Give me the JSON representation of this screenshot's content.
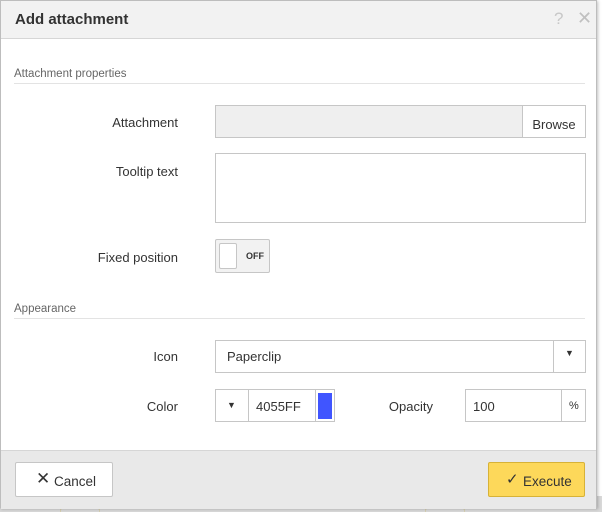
{
  "dialog": {
    "title": "Add attachment",
    "help_icon": "question-mark-icon",
    "close_icon": "close-icon"
  },
  "sections": {
    "properties": "Attachment properties",
    "appearance": "Appearance"
  },
  "fields": {
    "attachment": {
      "label": "Attachment",
      "value": "",
      "browse_label": "Browse"
    },
    "tooltip": {
      "label": "Tooltip text",
      "value": ""
    },
    "fixed_position": {
      "label": "Fixed position",
      "state": "OFF"
    },
    "icon": {
      "label": "Icon",
      "selected": "Paperclip"
    },
    "color": {
      "label": "Color",
      "hex": "4055FF",
      "swatch": "#4055FF"
    },
    "opacity": {
      "label": "Opacity",
      "value": "100",
      "unit": "%"
    }
  },
  "footer": {
    "cancel_label": "Cancel",
    "execute_label": "Execute"
  },
  "colors": {
    "execute_bg": "#FDD85A",
    "titlebar_bg": "#F2F2F2",
    "footer_bg": "#E9E9E9"
  }
}
